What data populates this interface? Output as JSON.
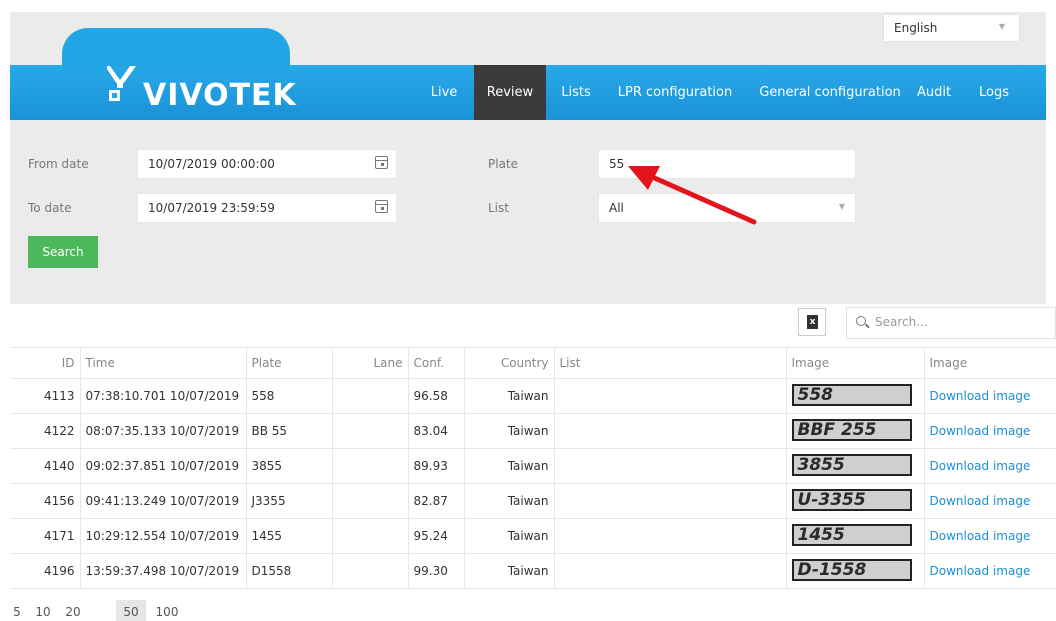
{
  "language": {
    "value": "English"
  },
  "brand": {
    "name": "VIVOTEK"
  },
  "nav": {
    "items": [
      {
        "label": "Live"
      },
      {
        "label": "Review"
      },
      {
        "label": "Lists"
      },
      {
        "label": "LPR configuration"
      },
      {
        "label": "General configuration"
      },
      {
        "label": "Audit"
      },
      {
        "label": "Logs"
      }
    ],
    "active": "Review"
  },
  "filters": {
    "from_label": "From date",
    "from_value": "10/07/2019 00:00:00",
    "to_label": "To date",
    "to_value": "10/07/2019 23:59:59",
    "plate_label": "Plate",
    "plate_value": "55",
    "list_label": "List",
    "list_value": "All",
    "search_label": "Search"
  },
  "table_tools": {
    "export_icon": "excel-export-icon",
    "search_placeholder": "Search..."
  },
  "table": {
    "columns": [
      "ID",
      "Time",
      "Plate",
      "Lane",
      "Conf.",
      "Country",
      "List",
      "Image",
      "Image"
    ],
    "rows": [
      {
        "id": "4113",
        "time": "07:38:10.701 10/07/2019",
        "plate": "558",
        "lane": "",
        "conf": "96.58",
        "country": "Taiwan",
        "list": "",
        "image_text": "558",
        "download": "Download image"
      },
      {
        "id": "4122",
        "time": "08:07:35.133 10/07/2019",
        "plate": "BB 55",
        "lane": "",
        "conf": "83.04",
        "country": "Taiwan",
        "list": "",
        "image_text": "BBF 255",
        "download": "Download image"
      },
      {
        "id": "4140",
        "time": "09:02:37.851 10/07/2019",
        "plate": "3855",
        "lane": "",
        "conf": "89.93",
        "country": "Taiwan",
        "list": "",
        "image_text": "3855",
        "download": "Download image"
      },
      {
        "id": "4156",
        "time": "09:41:13.249 10/07/2019",
        "plate": "J3355",
        "lane": "",
        "conf": "82.87",
        "country": "Taiwan",
        "list": "",
        "image_text": "U-3355",
        "download": "Download image"
      },
      {
        "id": "4171",
        "time": "10:29:12.554 10/07/2019",
        "plate": "1455",
        "lane": "",
        "conf": "95.24",
        "country": "Taiwan",
        "list": "",
        "image_text": "1455",
        "download": "Download image"
      },
      {
        "id": "4196",
        "time": "13:59:37.498 10/07/2019",
        "plate": "D1558",
        "lane": "",
        "conf": "99.30",
        "country": "Taiwan",
        "list": "",
        "image_text": "D-1558",
        "download": "Download image"
      }
    ]
  },
  "pagination": {
    "sizes": [
      "5",
      "10",
      "20",
      "50",
      "100"
    ],
    "active": "50"
  },
  "colors": {
    "header_blue": "#23a6e6",
    "active_tab": "#3b3b3b",
    "search_green": "#4cb85c",
    "link_blue": "#1b8fd4",
    "annotation_arrow": "#e3141c"
  }
}
